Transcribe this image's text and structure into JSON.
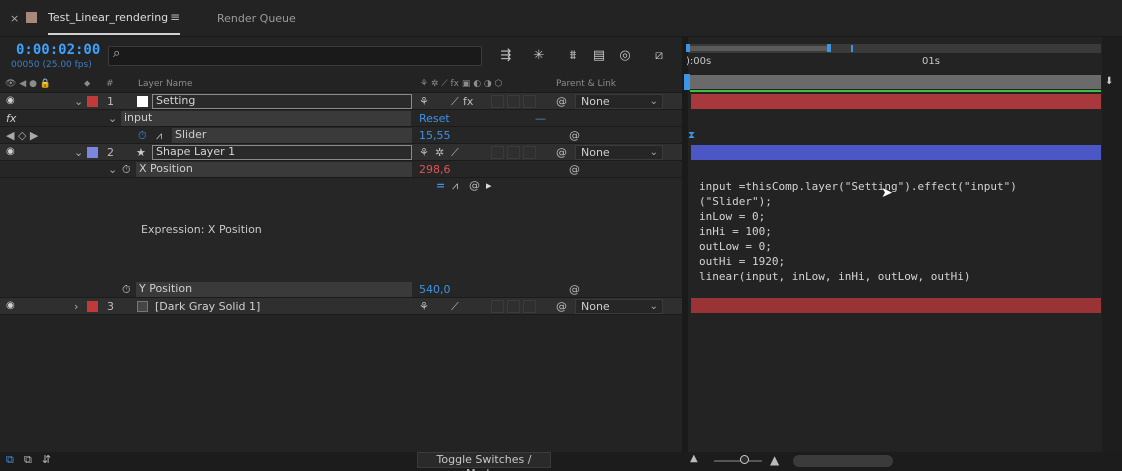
{
  "tabs": [
    {
      "label": "Test_Linear_rendering",
      "close": "×",
      "menu": "≡"
    },
    {
      "label": "Render Queue"
    }
  ],
  "timecode": "0:00:02:00",
  "frames": "00050 (25.00 fps)",
  "search": {
    "placeholder": "",
    "icon": "search-icon"
  },
  "header": {
    "layer_name": "Layer Name",
    "num": "#",
    "parent_link": "Parent & Link"
  },
  "layers": [
    {
      "num": "1",
      "name": "Setting",
      "color": "#c0393b",
      "parent": "None"
    },
    {
      "num": "2",
      "name": "Shape Layer 1",
      "color": "#7a86e0",
      "parent": "None"
    },
    {
      "num": "3",
      "name": "[Dark Gray Solid 1]",
      "color": "#c0393b",
      "parent": "None"
    }
  ],
  "effect": {
    "fx": "fx",
    "name": "input",
    "reset": "Reset",
    "dash": "—"
  },
  "slider": {
    "label": "Slider",
    "value": "15,55"
  },
  "xpos": {
    "label": "X Position",
    "value": "298,6"
  },
  "expr_label": "Expression: X Position",
  "ypos": {
    "label": "Y Position",
    "value": "540,0"
  },
  "expression": [
    "input =thisComp.layer(\"Setting\").effect(\"input\")",
    "(\"Slider\");",
    "inLow = 0;",
    "inHi = 100;",
    "outLow = 0;",
    "outHi = 1920;",
    "linear(input, inLow, inHi, outLow, outHi)"
  ],
  "ruler": {
    "start": "):00s",
    "mark": "01s"
  },
  "toggle": "Toggle Switches / Modes",
  "colors": {
    "accent": "#3da1ff",
    "red_bar": "#a8383b",
    "blue_bar": "#4b57c4",
    "green": "#3fbf3f"
  }
}
